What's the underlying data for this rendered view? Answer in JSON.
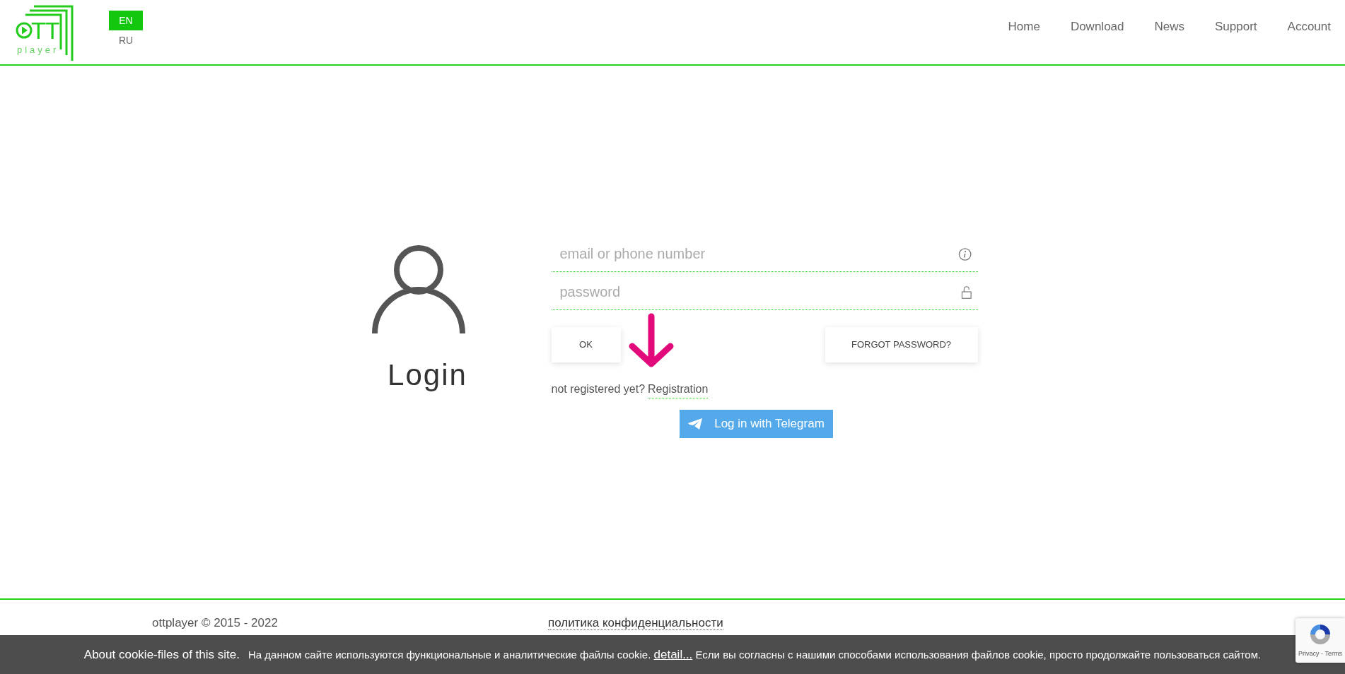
{
  "header": {
    "logo": {
      "text": "TT",
      "subtext": "player"
    },
    "languages": [
      {
        "label": "EN",
        "selected": true
      },
      {
        "label": "RU",
        "selected": false
      }
    ],
    "nav": [
      "Home",
      "Download",
      "News",
      "Support",
      "Account"
    ]
  },
  "login": {
    "title": "Login",
    "fields": [
      {
        "placeholder": "email or phone number",
        "kind": "info"
      },
      {
        "placeholder": "password",
        "kind": "lock"
      }
    ],
    "ok_button": "OK",
    "forgot_button": "FORGOT PASSWORD?",
    "register_prompt": "not registered yet?",
    "register_link": "Registration",
    "telegram_button": "Log in with Telegram"
  },
  "footer": {
    "copyright": "ottplayer © 2015 - 2022",
    "privacy_link": "политика конфиденциальности"
  },
  "cookie_bar": {
    "title": "About cookie-files of this site.",
    "text_before": "На данном сайте используются функциональные и аналитические файлы cookie.",
    "link": "detail...",
    "text_after": "Если вы согласны с нашими способами использования файлов cookie, просто продолжайте пользоваться сайтом."
  },
  "recaptcha": {
    "links": "Privacy - Terms"
  }
}
